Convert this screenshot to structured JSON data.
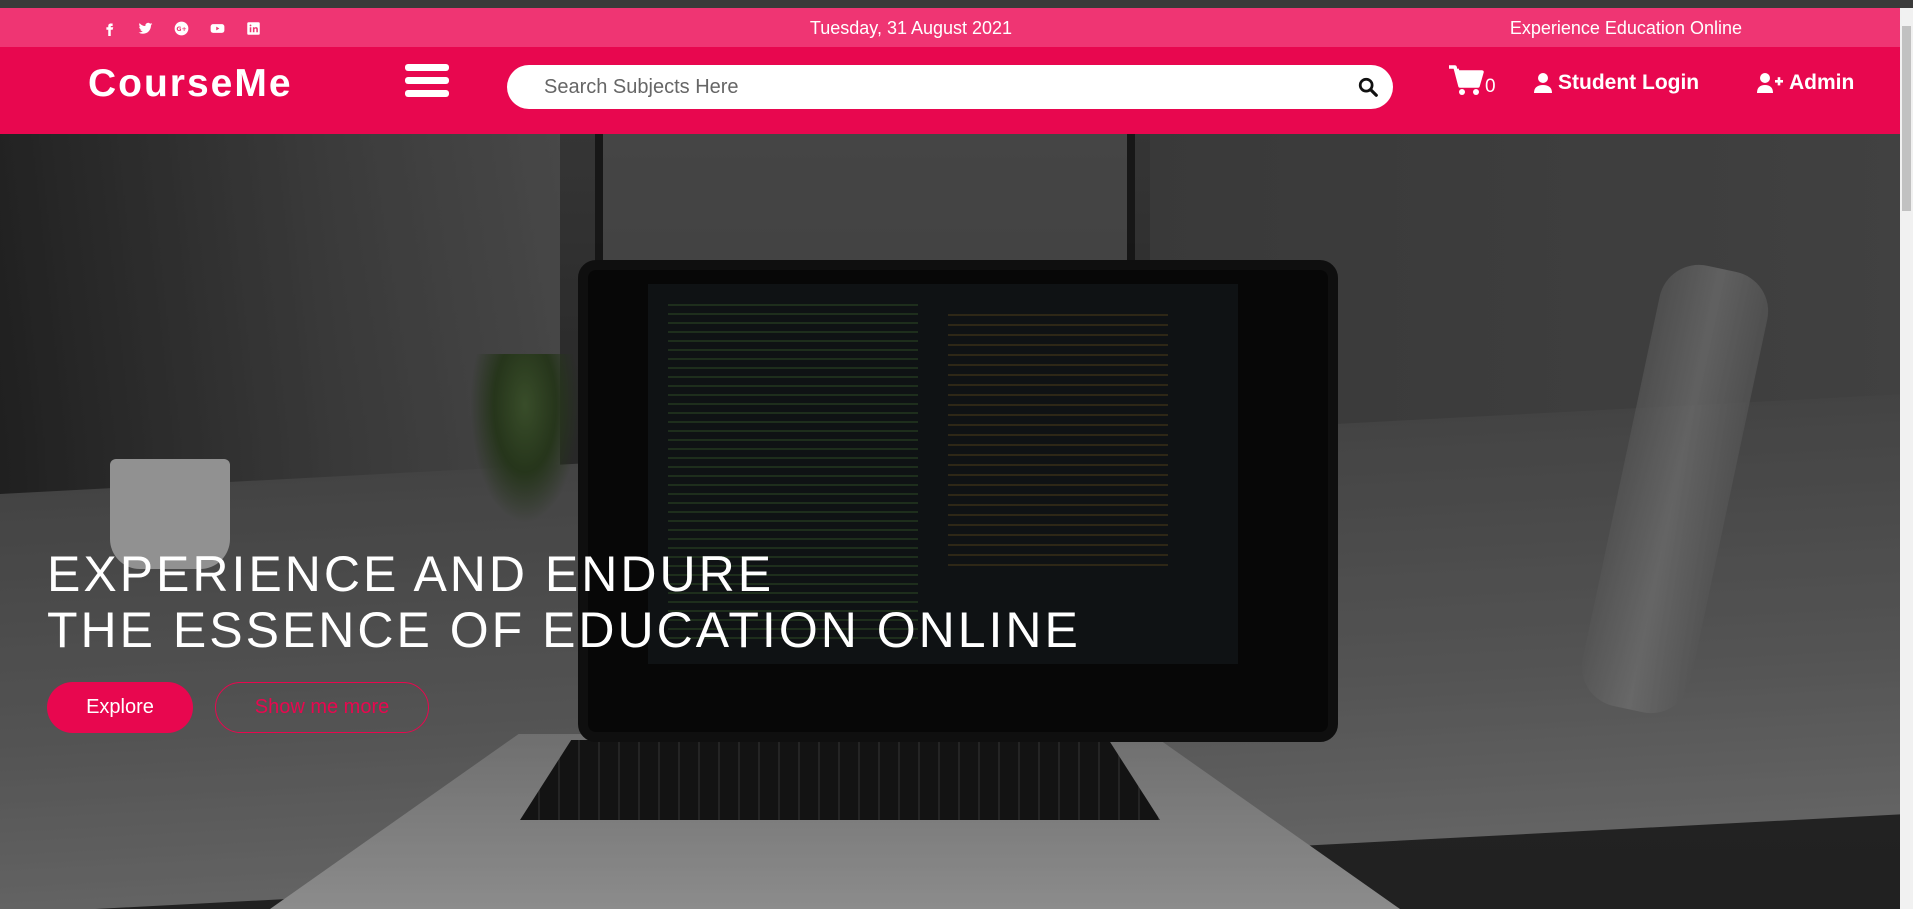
{
  "topbar": {
    "social_icons": [
      "facebook-icon",
      "twitter-icon",
      "google-plus-icon",
      "youtube-icon",
      "linkedin-icon"
    ],
    "date": "Tuesday, 31 August 2021",
    "tagline": "Experience Education Online"
  },
  "navbar": {
    "logo": "CourseMe",
    "menu_icon": "hamburger-menu-icon",
    "search": {
      "placeholder": "Search Subjects Here",
      "value": "",
      "icon": "search-icon"
    },
    "cart": {
      "icon": "shopping-cart-icon",
      "count": "0"
    },
    "student_login": {
      "icon": "user-icon",
      "label": "Student Login"
    },
    "admin": {
      "icon": "user-plus-icon",
      "label": "Admin"
    }
  },
  "hero": {
    "line1": "EXPERIENCE AND ENDURE",
    "line2": "THE ESSENCE OF EDUCATION ONLINE",
    "primary_button": "Explore",
    "secondary_button": "Show me more"
  },
  "colors": {
    "topbar": "#ef3573",
    "navbar": "#e8074f",
    "accent": "#e8074f"
  }
}
